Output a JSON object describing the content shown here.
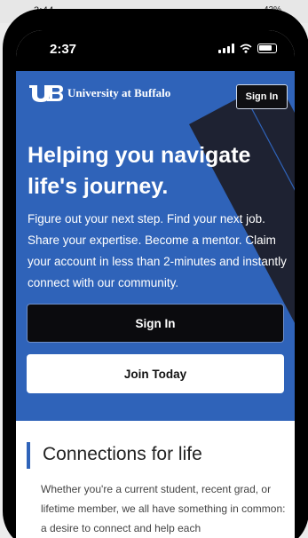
{
  "outer_status": {
    "time": "3:44",
    "battery": "42%"
  },
  "status_bar": {
    "time": "2:37"
  },
  "header": {
    "brand": "University at Buffalo",
    "signin_label": "Sign In"
  },
  "hero": {
    "headline": "Helping you navigate life's journey.",
    "description": "Figure out your next step. Find your next job. Share your expertise. Become a mentor. Claim your account in less than 2-minutes and instantly connect with our community.",
    "signin_button": "Sign In",
    "join_button": "Join Today"
  },
  "section": {
    "title": "Connections for life",
    "body": "Whether you're a current student, recent grad, or lifetime member, we all have something in common: a desire to connect and help each"
  },
  "colors": {
    "brand_blue": "#2f63b9",
    "dark": "#0b0b0e"
  }
}
